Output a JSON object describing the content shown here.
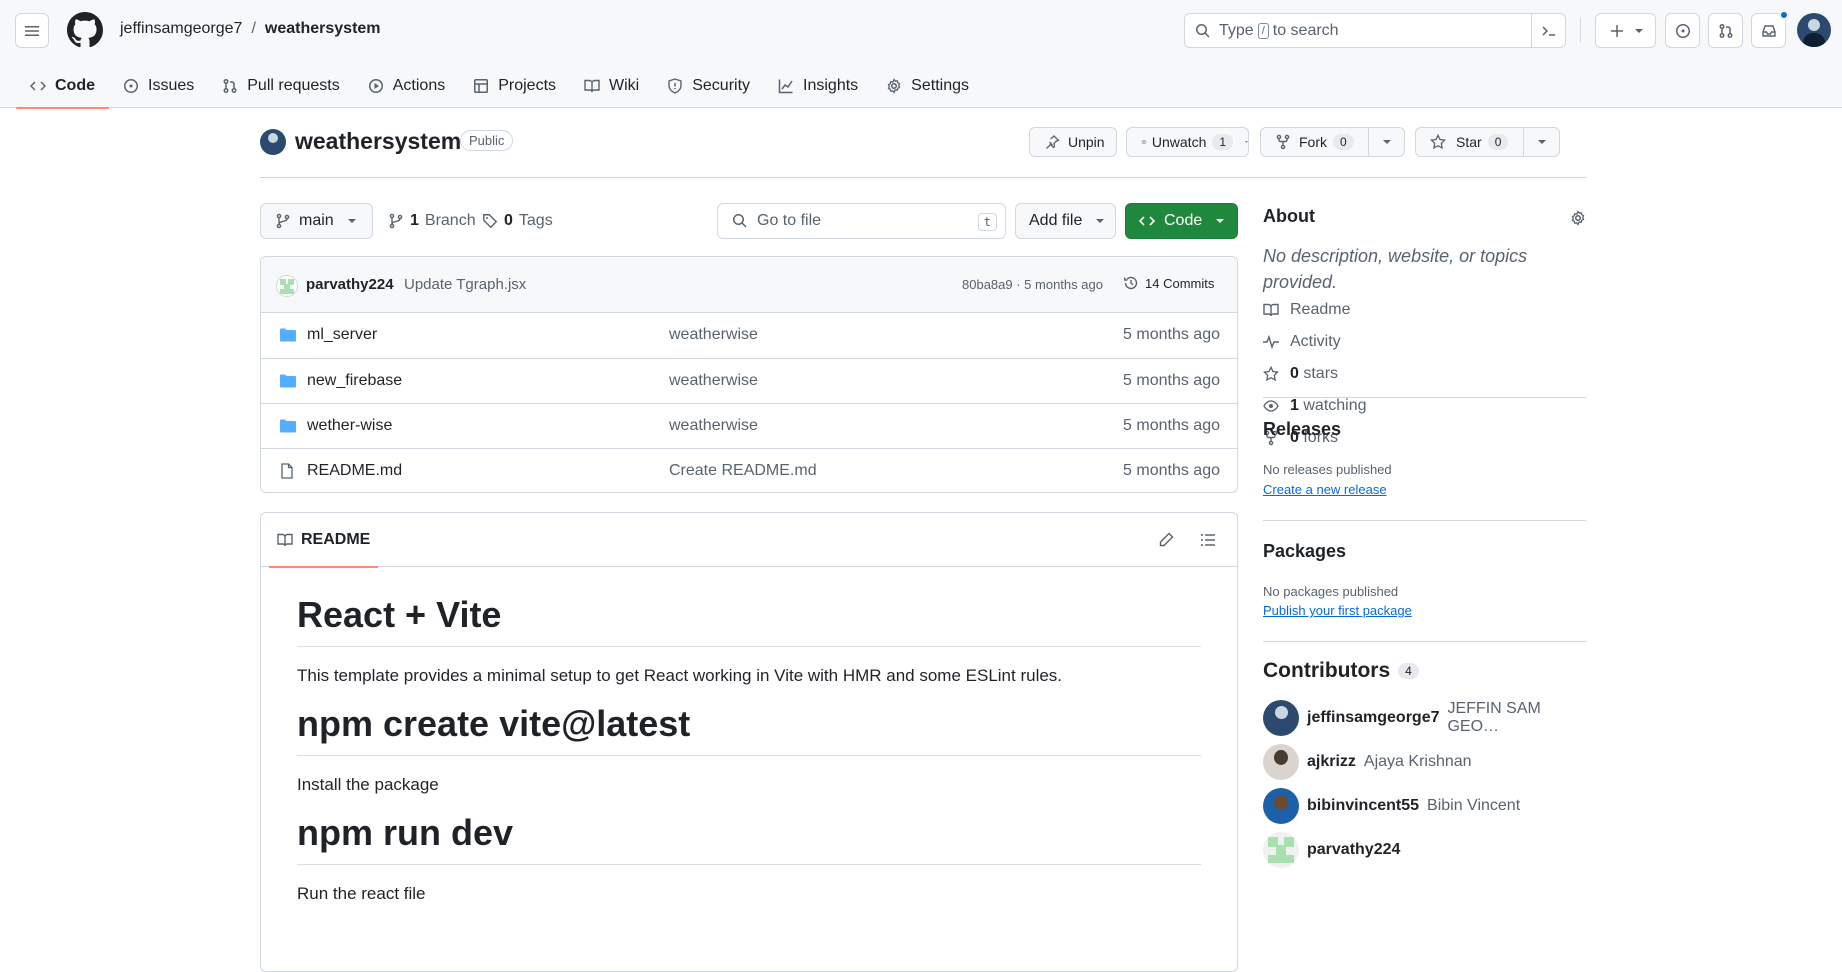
{
  "header": {
    "owner": "jeffinsamgeorge7",
    "separator": "/",
    "repo": "weathersystem",
    "search_prefix": "Type",
    "search_key": "/",
    "search_suffix": "to search"
  },
  "nav": {
    "tabs": [
      {
        "label": "Code",
        "icon": "code-icon",
        "selected": true
      },
      {
        "label": "Issues",
        "icon": "issue-icon"
      },
      {
        "label": "Pull requests",
        "icon": "pull-request-icon"
      },
      {
        "label": "Actions",
        "icon": "play-icon"
      },
      {
        "label": "Projects",
        "icon": "table-icon"
      },
      {
        "label": "Wiki",
        "icon": "book-icon"
      },
      {
        "label": "Security",
        "icon": "shield-icon"
      },
      {
        "label": "Insights",
        "icon": "graph-icon"
      },
      {
        "label": "Settings",
        "icon": "gear-icon"
      }
    ]
  },
  "repo": {
    "name": "weathersystem",
    "visibility": "Public",
    "unpin": "Unpin",
    "unwatch": "Unwatch",
    "watch_count": "1",
    "fork": "Fork",
    "fork_count": "0",
    "star": "Star",
    "star_count": "0"
  },
  "toolbar": {
    "branch": "main",
    "branch_count": "1",
    "branch_label": "Branch",
    "tag_count": "0",
    "tag_label": "Tags",
    "goto_placeholder": "Go to file",
    "goto_key": "t",
    "add_file": "Add file",
    "code": "Code"
  },
  "commit": {
    "author": "parvathy224",
    "message": "Update Tgraph.jsx",
    "sha_time": "80ba8a9 · 5 months ago",
    "count": "14 Commits"
  },
  "files": [
    {
      "name": "ml_server",
      "type": "folder",
      "message": "weatherwise",
      "time": "5 months ago"
    },
    {
      "name": "new_firebase",
      "type": "folder",
      "message": "weatherwise",
      "time": "5 months ago"
    },
    {
      "name": "wether-wise",
      "type": "folder",
      "message": "weatherwise",
      "time": "5 months ago"
    },
    {
      "name": "README.md",
      "type": "file",
      "message": "Create README.md",
      "time": "5 months ago"
    }
  ],
  "readme": {
    "tab": "README",
    "h1": "React + Vite",
    "p1": "This template provides a minimal setup to get React working in Vite with HMR and some ESLint rules.",
    "h2": "npm create vite@latest",
    "p2": "Install the package",
    "h3": "npm run dev",
    "p3": "Run the react file"
  },
  "about": {
    "title": "About",
    "description": "No description, website, or topics provided.",
    "readme": "Readme",
    "activity": "Activity",
    "stars_count": "0",
    "stars": "stars",
    "watching_count": "1",
    "watching": "watching",
    "forks_count": "0",
    "forks": "forks"
  },
  "releases": {
    "title": "Releases",
    "empty": "No releases published",
    "link": "Create a new release"
  },
  "packages": {
    "title": "Packages",
    "empty": "No packages published",
    "link": "Publish your first package"
  },
  "contributors": {
    "title": "Contributors",
    "count": "4",
    "list": [
      {
        "login": "jeffinsamgeorge7",
        "name": "JEFFIN SAM GEO…",
        "color": "#2b4a6e"
      },
      {
        "login": "ajkrizz",
        "name": "Ajaya Krishnan",
        "color": "#9a8f86"
      },
      {
        "login": "bibinvincent55",
        "name": "Bibin Vincent",
        "color": "#1d5fa8"
      },
      {
        "login": "parvathy224",
        "name": "",
        "color": "#a8e0b0"
      }
    ]
  },
  "colors": {
    "accent_green": "#1f883d",
    "link_blue": "#0969da",
    "folder_blue": "#54aeff",
    "tab_underline": "#fd8c73"
  }
}
